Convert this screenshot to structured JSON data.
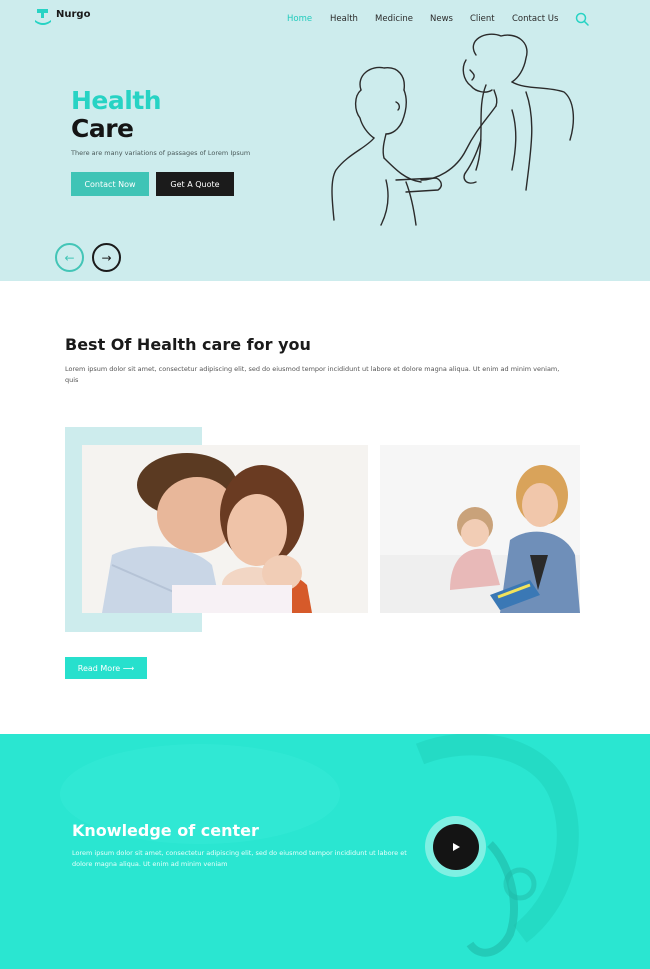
{
  "header": {
    "logo_text": "Nurgo",
    "nav": [
      {
        "label": "Home",
        "active": true
      },
      {
        "label": "Health",
        "active": false
      },
      {
        "label": "Medicine",
        "active": false
      },
      {
        "label": "News",
        "active": false
      },
      {
        "label": "Client",
        "active": false
      },
      {
        "label": "Contact Us",
        "active": false
      }
    ]
  },
  "hero": {
    "title_line1": "Health",
    "title_line2": "Care",
    "subtitle": "There are many variations of passages of Lorem Ipsum",
    "contact_button": "Contact Now",
    "quote_button": "Get A Quote",
    "prev_arrow": "←",
    "next_arrow": "→"
  },
  "care_section": {
    "title": "Best Of Health care for you",
    "text": "Lorem ipsum dolor sit amet, consectetur adipiscing elit, sed do eiusmod tempor incididunt ut labore et dolore magna aliqua. Ut enim ad minim veniam, quis",
    "read_more": "Read More ⟶"
  },
  "knowledge_section": {
    "title": "Knowledge of center",
    "text": "Lorem ipsum dolor sit amet, consectetur adipiscing elit, sed do eiusmod tempor incididunt ut labore et dolore magna aliqua. Ut enim ad minim veniam"
  },
  "colors": {
    "accent": "#27d3c4",
    "hero_bg": "#cdeced",
    "teal_bg": "#2ae6d1",
    "dark": "#1b1b1b"
  }
}
